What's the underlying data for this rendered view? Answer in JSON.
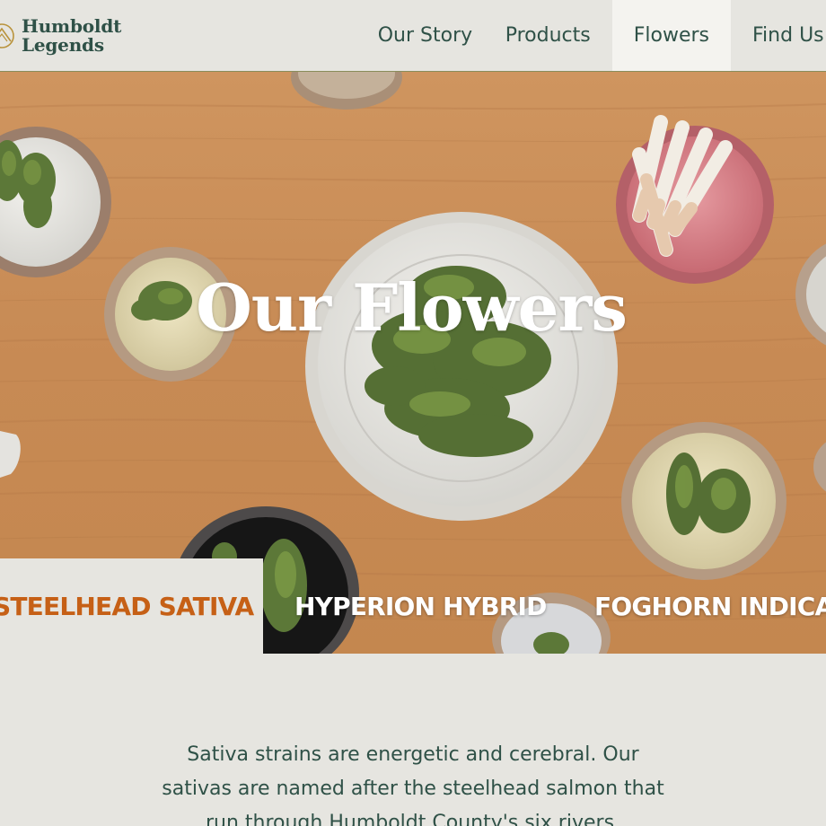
{
  "brand": {
    "name_line1": "Humboldt",
    "name_line2": "Legends",
    "logo_icon": "mountain-circle-logo"
  },
  "nav": {
    "items": [
      {
        "label": "Our Story",
        "active": false
      },
      {
        "label": "Products",
        "active": false
      },
      {
        "label": "Flowers",
        "active": true
      },
      {
        "label": "Find Us",
        "active": false
      }
    ]
  },
  "hero": {
    "title": "Our Flowers",
    "image": "flower-bowls-on-wood-table"
  },
  "strains": {
    "tabs": [
      {
        "label": "STEELHEAD SATIVA",
        "active": true
      },
      {
        "label": "HYPERION HYBRID",
        "active": false
      },
      {
        "label": "FOGHORN INDICA",
        "active": false
      }
    ]
  },
  "description": {
    "line1": "Sativa strains are energetic and cerebral. Our",
    "line2": "sativas are named after the steelhead salmon that",
    "line3": "run through Humboldt County's six rivers."
  },
  "colors": {
    "brand_green": "#2f5147",
    "accent_orange": "#c66016",
    "page_bg": "#e6e5e0",
    "nav_active_bg": "#f4f3ef",
    "wood": "#c98b56"
  }
}
